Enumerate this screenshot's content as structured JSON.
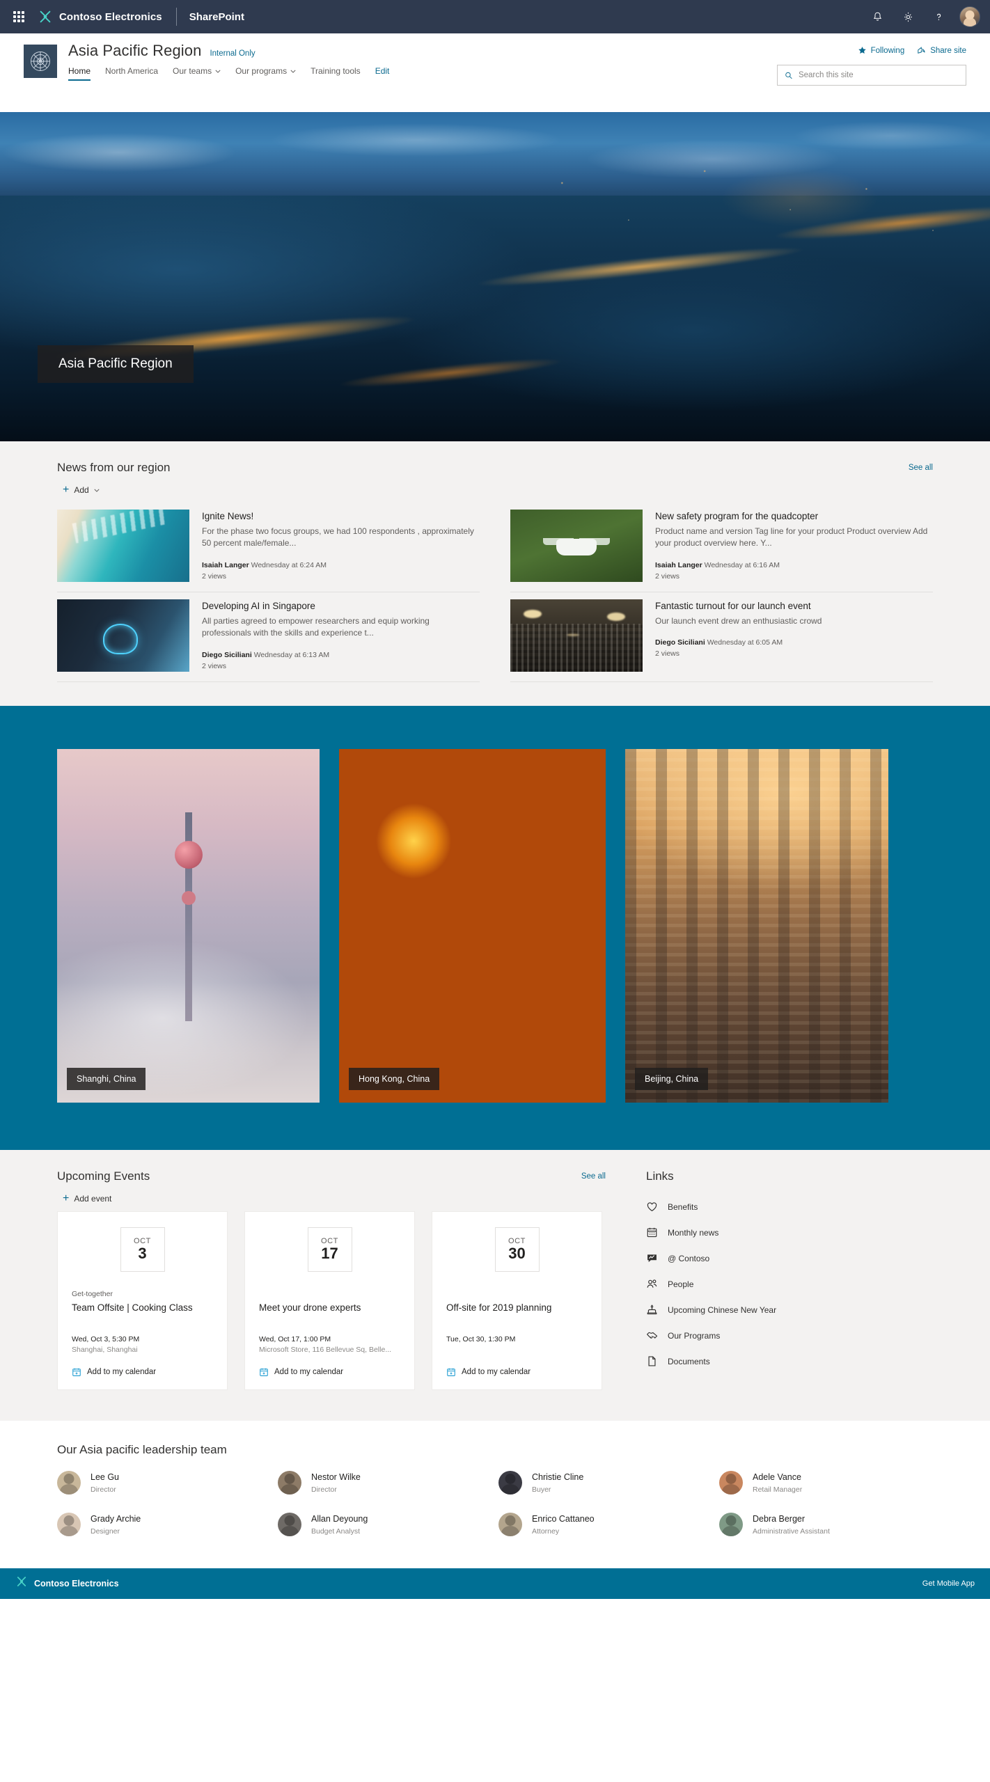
{
  "suitebar": {
    "waffle_label": "App launcher",
    "brand": "Contoso Electronics",
    "app": "SharePoint",
    "icons": [
      "notification-bell-icon",
      "settings-gear-icon",
      "help-question-icon"
    ],
    "avatar_label": "User avatar"
  },
  "site": {
    "title": "Asia Pacific Region",
    "classification": "Internal Only",
    "following_label": "Following",
    "share_label": "Share site",
    "search_placeholder": "Search this site",
    "search_value": "",
    "nav": [
      {
        "label": "Home",
        "selected": true,
        "has_chevron": false
      },
      {
        "label": "North America",
        "selected": false,
        "has_chevron": false
      },
      {
        "label": "Our teams",
        "selected": false,
        "has_chevron": true
      },
      {
        "label": "Our programs",
        "selected": false,
        "has_chevron": true
      },
      {
        "label": "Training tools",
        "selected": false,
        "has_chevron": false
      },
      {
        "label": "Edit",
        "selected": false,
        "has_chevron": false,
        "is_edit": true
      }
    ]
  },
  "hero": {
    "caption": "Asia Pacific Region"
  },
  "news": {
    "title": "News from our region",
    "see_all": "See all",
    "add_label": "Add",
    "items": [
      {
        "title": "Ignite News!",
        "description": "For the phase two focus groups, we had 100 respondents , approximately 50 percent male/female...",
        "author": "Isaiah Langer",
        "timestamp": "Wednesday at 6:24 AM",
        "views": "2 views",
        "thumb": "thumb-beach"
      },
      {
        "title": "New safety program for the quadcopter",
        "description": "Product name and version Tag line for your product Product overview Add your product overview here. Y...",
        "author": "Isaiah Langer",
        "timestamp": "Wednesday at 6:16 AM",
        "views": "2 views",
        "thumb": "thumb-drone"
      },
      {
        "title": "Developing AI in Singapore",
        "description": "All parties agreed to empower researchers and equip working professionals with the skills and experience t...",
        "author": "Diego Siciliani",
        "timestamp": "Wednesday at 6:13 AM",
        "views": "2 views",
        "thumb": "thumb-ai"
      },
      {
        "title": "Fantastic turnout for our launch event",
        "description": "Our launch event drew an enthusiastic crowd",
        "author": "Diego Siciliani",
        "timestamp": "Wednesday at 6:05 AM",
        "views": "2 views",
        "thumb": "thumb-crowd"
      }
    ]
  },
  "gallery": {
    "items": [
      {
        "caption": "Shanghi, China",
        "img": "img-shanghai"
      },
      {
        "caption": "Hong Kong, China",
        "img": "img-lanterns"
      },
      {
        "caption": "Beijing, China",
        "img": "img-beijing"
      }
    ]
  },
  "events": {
    "title": "Upcoming Events",
    "see_all": "See all",
    "add_label": "Add event",
    "add_to_calendar_label": "Add to my calendar",
    "items": [
      {
        "month": "OCT",
        "day": "3",
        "category": "Get-together",
        "title": "Team Offsite | Cooking Class",
        "when": "Wed, Oct 3, 5:30 PM",
        "where": "Shanghai, Shanghai"
      },
      {
        "month": "OCT",
        "day": "17",
        "category": "",
        "title": "Meet your drone experts",
        "when": "Wed, Oct 17, 1:00 PM",
        "where": "Microsoft Store, 116 Bellevue Sq, Belle..."
      },
      {
        "month": "OCT",
        "day": "30",
        "category": "",
        "title": "Off-site for 2019 planning",
        "when": "Tue, Oct 30, 1:30 PM",
        "where": ""
      }
    ]
  },
  "links": {
    "title": "Links",
    "items": [
      {
        "label": "Benefits",
        "icon": "heart-icon"
      },
      {
        "label": "Monthly news",
        "icon": "calendar-icon"
      },
      {
        "label": "@ Contoso",
        "icon": "chat-bubble-icon"
      },
      {
        "label": "People",
        "icon": "people-icon"
      },
      {
        "label": "Upcoming Chinese New Year",
        "icon": "cake-icon"
      },
      {
        "label": "Our Programs",
        "icon": "handshake-icon"
      },
      {
        "label": "Documents",
        "icon": "document-icon"
      }
    ]
  },
  "people": {
    "title": "Our Asia pacific leadership team",
    "members": [
      {
        "name": "Lee Gu",
        "role": "Director",
        "color": "#c8b79a"
      },
      {
        "name": "Nestor Wilke",
        "role": "Director",
        "color": "#8d7b67"
      },
      {
        "name": "Christie Cline",
        "role": "Buyer",
        "color": "#3b3b44"
      },
      {
        "name": "Adele Vance",
        "role": "Retail Manager",
        "color": "#c9875f"
      },
      {
        "name": "Grady Archie",
        "role": "Designer",
        "color": "#d8c6b4"
      },
      {
        "name": "Allan Deyoung",
        "role": "Budget Analyst",
        "color": "#6e6a66"
      },
      {
        "name": "Enrico Cattaneo",
        "role": "Attorney",
        "color": "#b3a58d"
      },
      {
        "name": "Debra Berger",
        "role": "Administrative Assistant",
        "color": "#7f9a86"
      }
    ]
  },
  "footer": {
    "brand": "Contoso Electronics",
    "mobile_app_label": "Get Mobile App"
  },
  "colors": {
    "suitebar_bg": "#2f3a4f",
    "accent": "#0b6a8f",
    "band_teal": "#006f94",
    "section_grey": "#f3f2f1"
  }
}
